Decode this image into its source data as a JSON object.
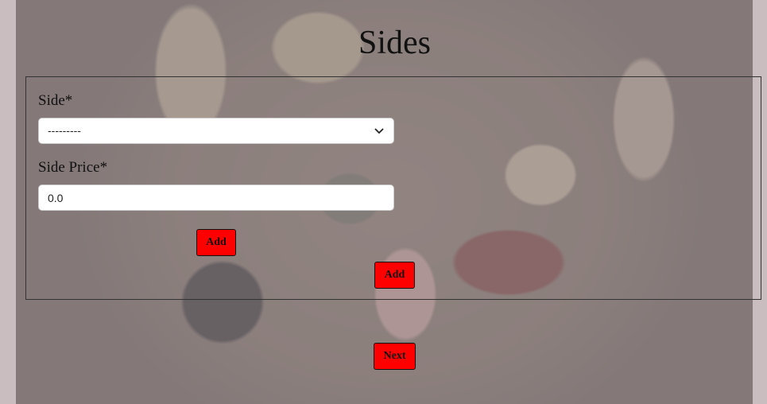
{
  "page": {
    "title": "Sides"
  },
  "form": {
    "side_label": "Side*",
    "side_select_value": "---------",
    "side_price_label": "Side Price*",
    "side_price_value": "0.0"
  },
  "buttons": {
    "add_inner": "Add",
    "add_outer": "Add",
    "next": "Next"
  },
  "icons": {
    "select_chevron": "chevron-down-icon"
  },
  "colors": {
    "button_bg": "#ff0000"
  }
}
